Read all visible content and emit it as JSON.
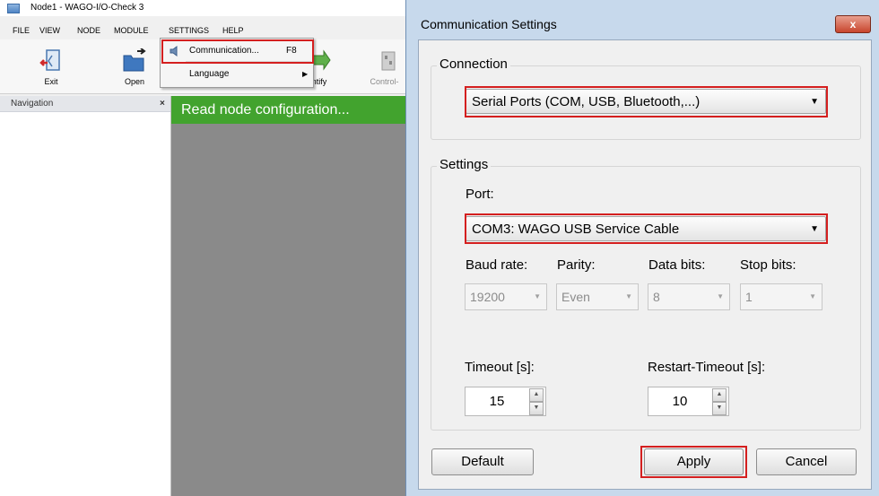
{
  "app": {
    "title": "Node1 - WAGO-I/O-Check 3",
    "menu": [
      "FILE",
      "VIEW",
      "NODE",
      "MODULE",
      "SETTINGS",
      "HELP"
    ],
    "toolbar": {
      "exit": "Exit",
      "open": "Open",
      "identify": "ntify",
      "control": "Control-"
    },
    "settings_menu": {
      "communication": "Communication...",
      "communication_shortcut": "F8",
      "language": "Language"
    },
    "navigation": {
      "header": "Navigation",
      "close": "×"
    },
    "status": "Read node configuration..."
  },
  "dialog": {
    "title": "Communication Settings",
    "close": "x",
    "connection": {
      "group_label": "Connection",
      "value": "Serial Ports (COM, USB, Bluetooth,...)"
    },
    "settings": {
      "group_label": "Settings",
      "port_label": "Port:",
      "port_value": "COM3: WAGO USB Service Cable",
      "baud_label": "Baud rate:",
      "baud_value": "19200",
      "parity_label": "Parity:",
      "parity_value": "Even",
      "databits_label": "Data bits:",
      "databits_value": "8",
      "stopbits_label": "Stop bits:",
      "stopbits_value": "1",
      "timeout_label": "Timeout [s]:",
      "timeout_value": "15",
      "restart_label": "Restart-Timeout [s]:",
      "restart_value": "10"
    },
    "buttons": {
      "default": "Default",
      "apply": "Apply",
      "cancel": "Cancel"
    }
  },
  "colors": {
    "highlight": "#d41f1f",
    "status_bar": "#42a32e",
    "dialog_frame": "#c7d9ec"
  }
}
